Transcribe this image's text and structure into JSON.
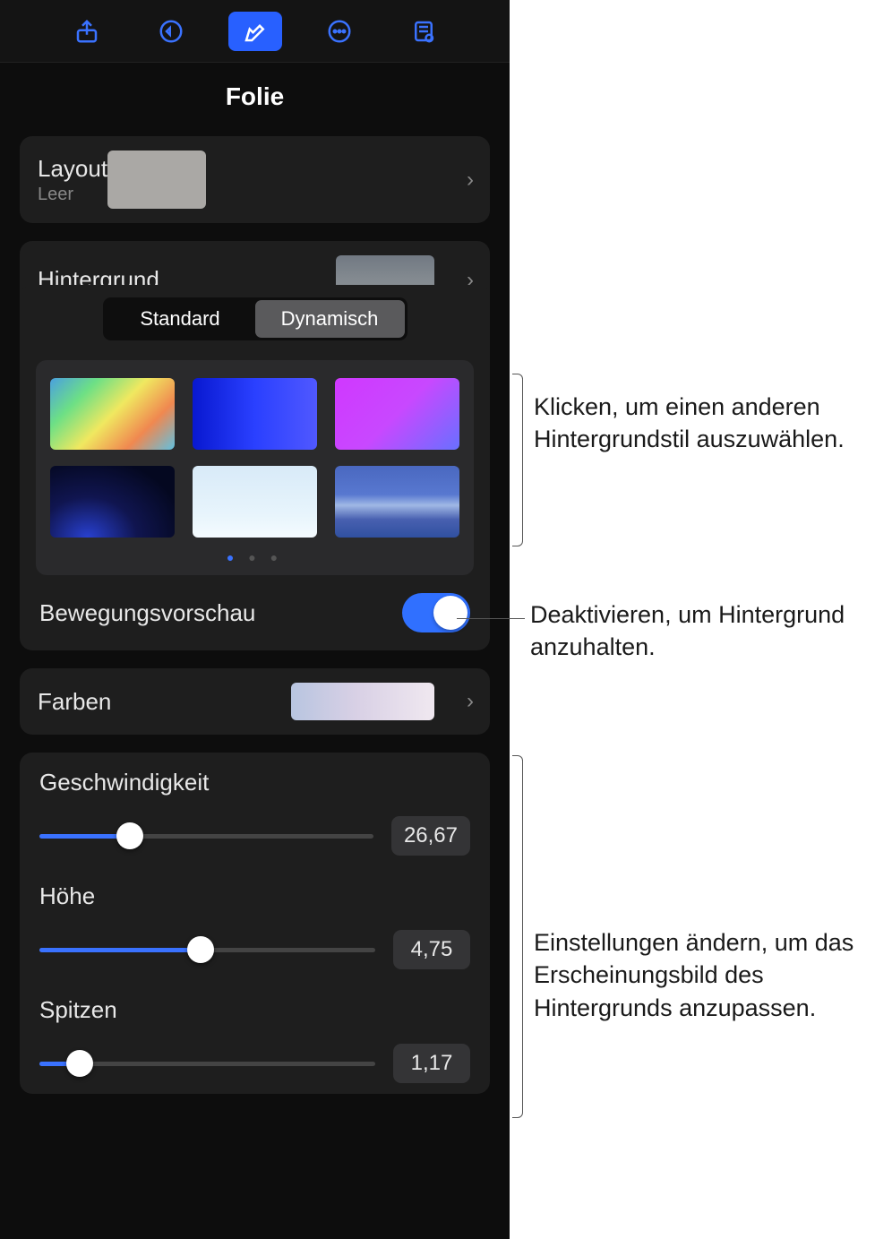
{
  "panel": {
    "title": "Folie"
  },
  "layout": {
    "label": "Layout",
    "sublabel": "Leer"
  },
  "background": {
    "label": "Hintergrund"
  },
  "segmented": {
    "standard": "Standard",
    "dynamic": "Dynamisch"
  },
  "motionPreview": {
    "label": "Bewegungsvorschau"
  },
  "colors": {
    "label": "Farben"
  },
  "sliders": {
    "speed": {
      "label": "Geschwindigkeit",
      "value": "26,67",
      "percent": 27
    },
    "height": {
      "label": "Höhe",
      "value": "4,75",
      "percent": 48
    },
    "peaks": {
      "label": "Spitzen",
      "value": "1,17",
      "percent": 12
    }
  },
  "callouts": {
    "styles": "Klicken, um einen anderen Hintergrundstil auszuwählen.",
    "toggle": "Deaktivieren, um Hintergrund anzuhalten.",
    "sliders": "Einstellungen ändern, um das Erscheinungsbild des Hintergrunds anzupassen."
  }
}
